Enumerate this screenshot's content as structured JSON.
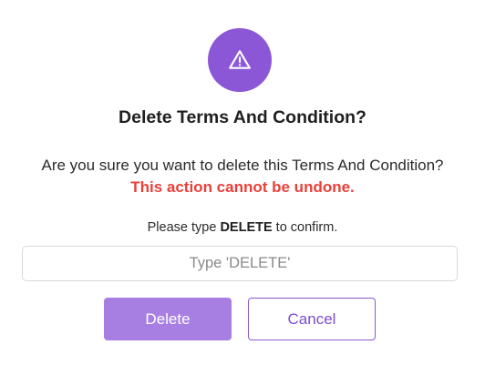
{
  "dialog": {
    "icon": "warning-triangle-icon",
    "title": "Delete Terms And Condition?",
    "message": "Are you sure you want to delete this Terms And Condition?",
    "warning": "This action cannot be undone.",
    "confirm_prefix": "Please type ",
    "confirm_keyword": "DELETE",
    "confirm_suffix": " to confirm.",
    "input": {
      "value": "",
      "placeholder": "Type 'DELETE'"
    },
    "delete_label": "Delete",
    "cancel_label": "Cancel"
  },
  "colors": {
    "accent": "#8b57d6",
    "delete_button": "#a77fe3",
    "warning_text": "#e8403a"
  }
}
